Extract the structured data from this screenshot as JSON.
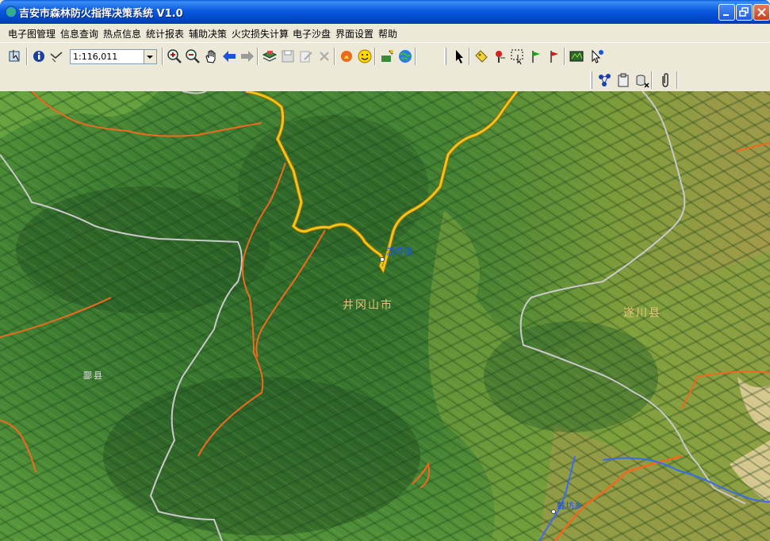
{
  "window": {
    "title": "吉安市森林防火指挥决策系统 V1.0"
  },
  "menu": {
    "items": [
      "电子图管理",
      "信息查询",
      "热点信息",
      "统计报表",
      "辅助决策",
      "火灾损失计算",
      "电子沙盘",
      "界面设置",
      "帮助"
    ]
  },
  "toolbar": {
    "scale_value": "1:116,011"
  },
  "map": {
    "labels": {
      "jinggangshan": "井冈山市",
      "suichuan": "遂川县",
      "lingxian": "酃县",
      "ciping": "茨坪镇",
      "dafen": "戴坊乡"
    }
  },
  "colors": {
    "title_bar": "#0b5ae0",
    "chrome": "#ece9d8",
    "road_yellow": "#f0c419",
    "boundary_orange": "#f06a1e",
    "boundary_gray": "#c8c8c8",
    "river_blue": "#3a6cf0"
  }
}
